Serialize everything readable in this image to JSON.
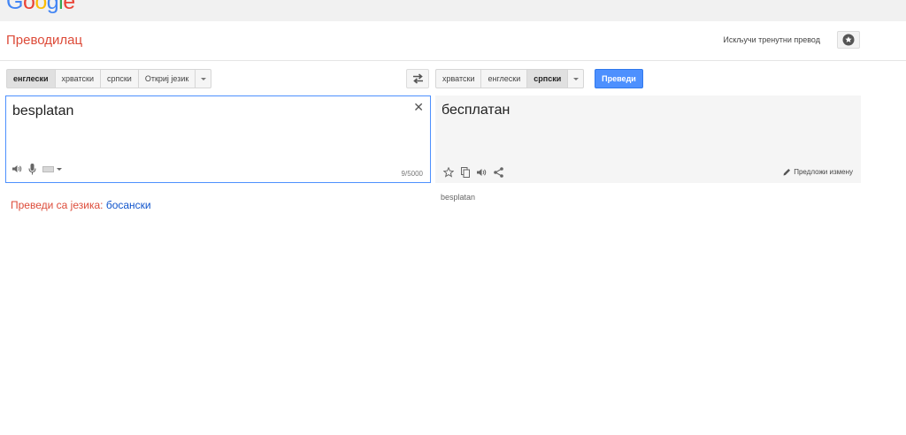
{
  "logo": {
    "text": "Google",
    "letters": [
      {
        "ch": "G",
        "color": "#4285f4"
      },
      {
        "ch": "o",
        "color": "#ea4335"
      },
      {
        "ch": "o",
        "color": "#fbbc05"
      },
      {
        "ch": "g",
        "color": "#4285f4"
      },
      {
        "ch": "l",
        "color": "#34a853"
      },
      {
        "ch": "e",
        "color": "#ea4335"
      }
    ]
  },
  "header": {
    "title": "Преводилац",
    "instant_toggle": "Искључи тренутни превод",
    "star_icon": "star-circle-icon"
  },
  "source_langs": {
    "items": [
      "енглески",
      "хрватски",
      "српски",
      "Откриј језик"
    ],
    "active_index": 0
  },
  "target_langs": {
    "items": [
      "хрватски",
      "енглески",
      "српски"
    ],
    "active_index": 2
  },
  "translate_button": "Преведи",
  "source": {
    "text": "besplatan",
    "char_count": "9/5000"
  },
  "target": {
    "text": "бесплатан",
    "suggest_edit": "Предложи измену",
    "transliteration": "besplatan"
  },
  "detect": {
    "prefix": "Преведи са језика:",
    "language": "босански"
  },
  "colors": {
    "accent_red": "#dd4b39",
    "link_blue": "#1155cc",
    "button_blue": "#4d90fe"
  }
}
